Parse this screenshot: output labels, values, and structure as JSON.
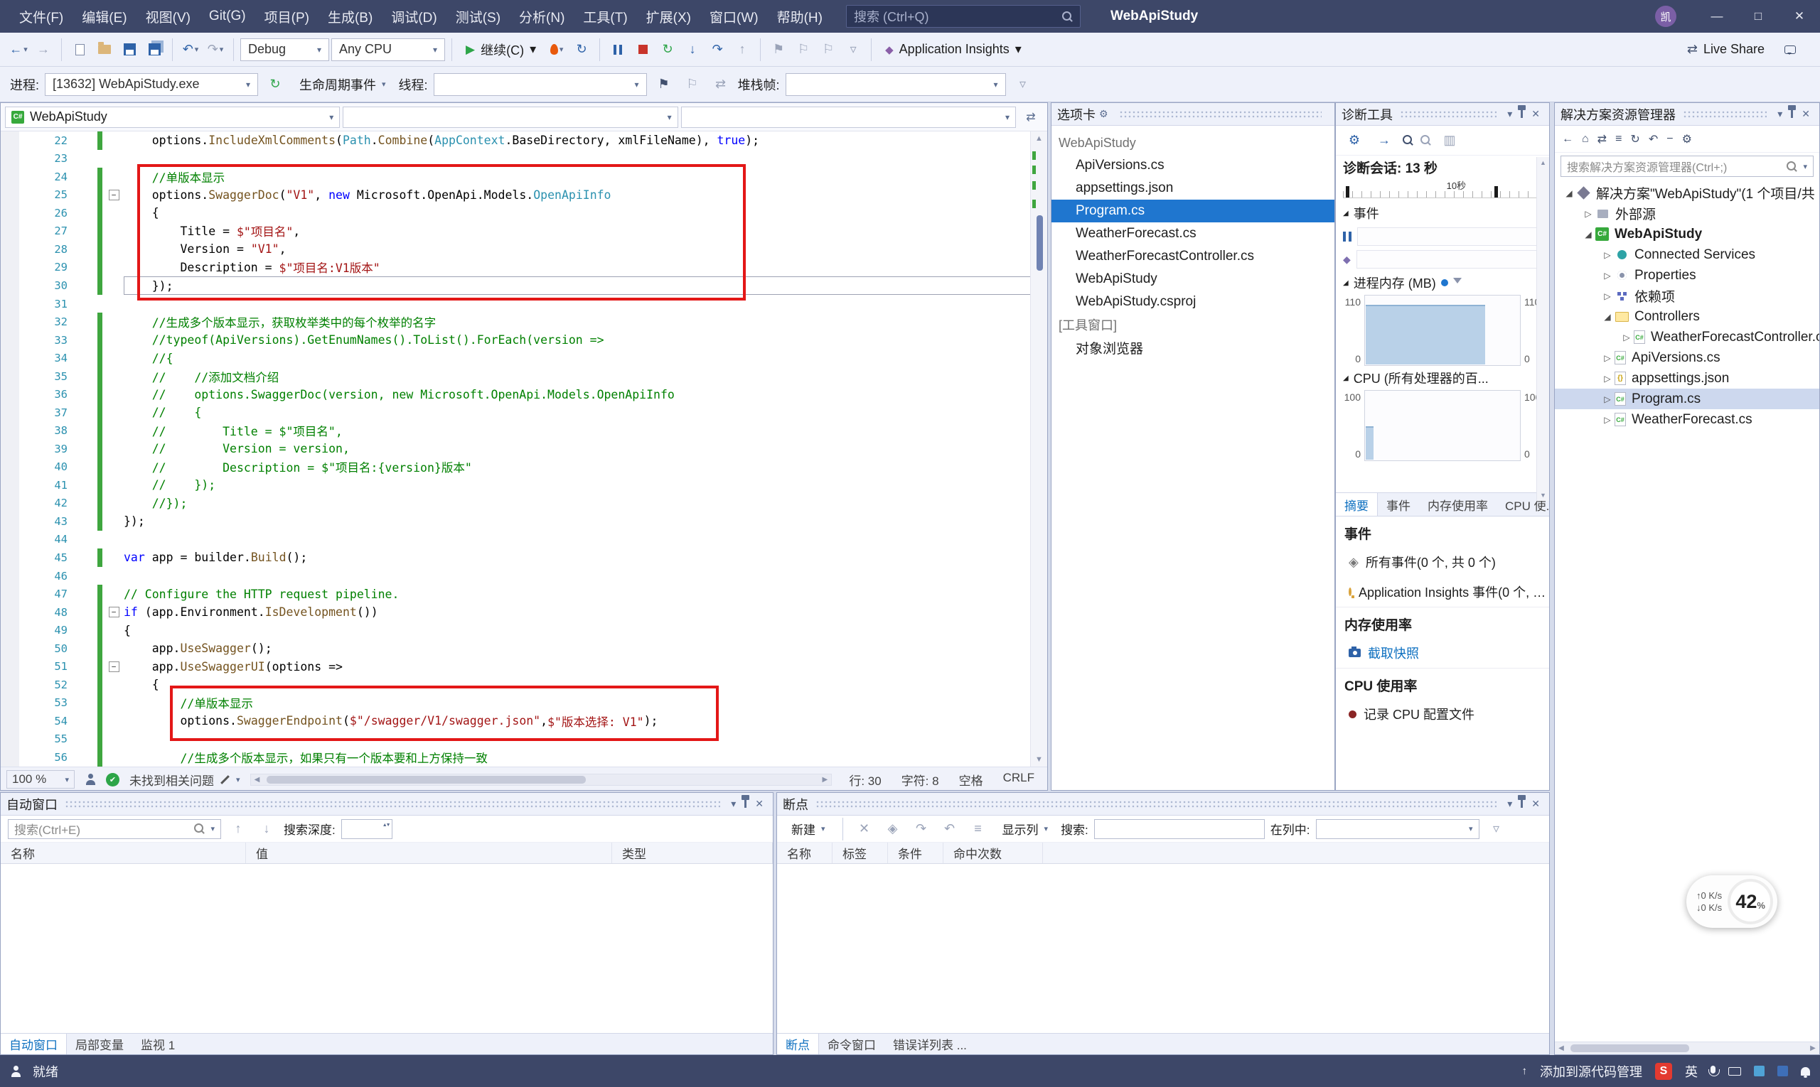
{
  "icons": {
    "dropdown": "▾",
    "overflow": "▿",
    "close": "✕",
    "minimize": "—",
    "maximize": "□",
    "gear": "⚙",
    "expanded": "◢",
    "collapsed": "▷",
    "up": "▲",
    "down": "▼",
    "left": "◀",
    "right": "▶",
    "undo": "↶",
    "redo": "↷",
    "refresh": "↻",
    "back": "←",
    "forward": "→",
    "flag": "⚑",
    "flag2": "⚐",
    "step_into": "↓",
    "step_over": "↷",
    "step_out": "↑",
    "play": "▶",
    "check": "✔",
    "fold": "−",
    "swap": "⇄",
    "home": "⌂",
    "diamond": "◆",
    "list": "≡",
    "chart": "▥",
    "allevents": "◈"
  },
  "title_bar": {
    "menus": [
      "文件(F)",
      "编辑(E)",
      "视图(V)",
      "Git(G)",
      "项目(P)",
      "生成(B)",
      "调试(D)",
      "测试(S)",
      "分析(N)",
      "工具(T)",
      "扩展(X)",
      "窗口(W)",
      "帮助(H)"
    ],
    "search_placeholder": "搜索 (Ctrl+Q)",
    "app_title": "WebApiStudy",
    "avatar": "凯"
  },
  "toolbar_main": {
    "config": "Debug",
    "platform": "Any CPU",
    "continue_label": "继续(C)",
    "app_insights_label": "Application Insights",
    "live_share_label": "Live Share"
  },
  "toolbar_debug": {
    "process_label": "进程:",
    "process_value": "[13632] WebApiStudy.exe",
    "lifecycle_label": "生命周期事件",
    "thread_label": "线程:",
    "stack_label": "堆栈帧:"
  },
  "editor": {
    "nav_project": "WebApiStudy",
    "zoom": "100 %",
    "health": "未找到相关问题",
    "line_status": "行: 30",
    "char_status": "字符: 8",
    "spaces_status": "空格",
    "eol_status": "CRLF",
    "code": [
      {
        "num": 22,
        "chg": true,
        "seg": [
          [
            "pl",
            "    options."
          ],
          [
            "mth",
            "IncludeXmlComments"
          ],
          [
            "pl",
            "("
          ],
          [
            "cls",
            "Path"
          ],
          [
            "pl",
            "."
          ],
          [
            "mth",
            "Combine"
          ],
          [
            "pl",
            "("
          ],
          [
            "cls",
            "AppContext"
          ],
          [
            "pl",
            ".BaseDirectory, xmlFileName), "
          ],
          [
            "kw",
            "true"
          ],
          [
            "pl",
            ");"
          ]
        ]
      },
      {
        "num": 23,
        "seg": []
      },
      {
        "num": 24,
        "chg": true,
        "seg": [
          [
            "cm",
            "    //单版本显示"
          ]
        ]
      },
      {
        "num": 25,
        "chg": true,
        "fold": true,
        "seg": [
          [
            "pl",
            "    options."
          ],
          [
            "mth",
            "SwaggerDoc"
          ],
          [
            "pl",
            "("
          ],
          [
            "str",
            "\"V1\""
          ],
          [
            "pl",
            ", "
          ],
          [
            "kw",
            "new"
          ],
          [
            "pl",
            " Microsoft.OpenApi.Models."
          ],
          [
            "cls",
            "OpenApiInfo"
          ]
        ]
      },
      {
        "num": 26,
        "chg": true,
        "seg": [
          [
            "pl",
            "    {"
          ]
        ]
      },
      {
        "num": 27,
        "chg": true,
        "seg": [
          [
            "pl",
            "        Title = "
          ],
          [
            "str",
            "$\"项目名\""
          ],
          [
            "pl",
            ","
          ]
        ]
      },
      {
        "num": 28,
        "chg": true,
        "seg": [
          [
            "pl",
            "        Version = "
          ],
          [
            "str",
            "\"V1\""
          ],
          [
            "pl",
            ","
          ]
        ]
      },
      {
        "num": 29,
        "chg": true,
        "seg": [
          [
            "pl",
            "        Description = "
          ],
          [
            "str",
            "$\"项目名:V1版本\""
          ]
        ]
      },
      {
        "num": 30,
        "chg": true,
        "cur": true,
        "seg": [
          [
            "pl",
            "    });"
          ]
        ]
      },
      {
        "num": 31,
        "seg": []
      },
      {
        "num": 32,
        "chg": true,
        "seg": [
          [
            "cm",
            "    //生成多个版本显示，获取枚举类中的每个枚举的名字"
          ]
        ]
      },
      {
        "num": 33,
        "chg": true,
        "seg": [
          [
            "cm",
            "    //typeof(ApiVersions).GetEnumNames().ToList().ForEach(version =>"
          ]
        ]
      },
      {
        "num": 34,
        "chg": true,
        "seg": [
          [
            "cm",
            "    //{"
          ]
        ]
      },
      {
        "num": 35,
        "chg": true,
        "seg": [
          [
            "cm",
            "    //    //添加文档介绍"
          ]
        ]
      },
      {
        "num": 36,
        "chg": true,
        "seg": [
          [
            "cm",
            "    //    options.SwaggerDoc(version, new Microsoft.OpenApi.Models.OpenApiInfo"
          ]
        ]
      },
      {
        "num": 37,
        "chg": true,
        "seg": [
          [
            "cm",
            "    //    {"
          ]
        ]
      },
      {
        "num": 38,
        "chg": true,
        "seg": [
          [
            "cm",
            "    //        Title = $\"项目名\","
          ]
        ]
      },
      {
        "num": 39,
        "chg": true,
        "seg": [
          [
            "cm",
            "    //        Version = version,"
          ]
        ]
      },
      {
        "num": 40,
        "chg": true,
        "seg": [
          [
            "cm",
            "    //        Description = $\"项目名:{version}版本\""
          ]
        ]
      },
      {
        "num": 41,
        "chg": true,
        "seg": [
          [
            "cm",
            "    //    });"
          ]
        ]
      },
      {
        "num": 42,
        "chg": true,
        "seg": [
          [
            "cm",
            "    //});"
          ]
        ]
      },
      {
        "num": 43,
        "chg": true,
        "seg": [
          [
            "pl",
            "});"
          ]
        ]
      },
      {
        "num": 44,
        "seg": []
      },
      {
        "num": 45,
        "chg": true,
        "seg": [
          [
            "kw",
            "var"
          ],
          [
            "pl",
            " app = builder."
          ],
          [
            "mth",
            "Build"
          ],
          [
            "pl",
            "();"
          ]
        ]
      },
      {
        "num": 46,
        "seg": []
      },
      {
        "num": 47,
        "chg": true,
        "seg": [
          [
            "cm",
            "// Configure the HTTP request pipeline."
          ]
        ]
      },
      {
        "num": 48,
        "chg": true,
        "fold": true,
        "seg": [
          [
            "kw",
            "if"
          ],
          [
            "pl",
            " (app.Environment."
          ],
          [
            "mth",
            "IsDevelopment"
          ],
          [
            "pl",
            "())"
          ]
        ]
      },
      {
        "num": 49,
        "chg": true,
        "seg": [
          [
            "pl",
            "{"
          ]
        ]
      },
      {
        "num": 50,
        "chg": true,
        "seg": [
          [
            "pl",
            "    app."
          ],
          [
            "mth",
            "UseSwagger"
          ],
          [
            "pl",
            "();"
          ]
        ]
      },
      {
        "num": 51,
        "chg": true,
        "fold": true,
        "seg": [
          [
            "pl",
            "    app."
          ],
          [
            "mth",
            "UseSwaggerUI"
          ],
          [
            "pl",
            "(options =>"
          ]
        ]
      },
      {
        "num": 52,
        "chg": true,
        "seg": [
          [
            "pl",
            "    {"
          ]
        ]
      },
      {
        "num": 53,
        "chg": true,
        "seg": [
          [
            "cm",
            "        //单版本显示"
          ]
        ]
      },
      {
        "num": 54,
        "chg": true,
        "seg": [
          [
            "pl",
            "        options."
          ],
          [
            "mth",
            "SwaggerEndpoint"
          ],
          [
            "pl",
            "("
          ],
          [
            "str",
            "$\"/swagger/V1/swagger.json\""
          ],
          [
            "pl",
            ","
          ],
          [
            "str",
            "$\"版本选择: V1\""
          ],
          [
            "pl",
            ");"
          ]
        ]
      },
      {
        "num": 55,
        "chg": true,
        "seg": []
      },
      {
        "num": 56,
        "chg": true,
        "seg": [
          [
            "cm",
            "        //生成多个版本显示，如果只有一个版本要和上方保持一致"
          ]
        ]
      }
    ]
  },
  "tabs_panel": {
    "title": "选项卡",
    "groups": [
      {
        "header": "WebApiStudy",
        "items": [
          {
            "label": "ApiVersions.cs"
          },
          {
            "label": "appsettings.json"
          },
          {
            "label": "Program.cs",
            "selected": true
          },
          {
            "label": "WeatherForecast.cs"
          },
          {
            "label": "WeatherForecastController.cs"
          },
          {
            "label": "WebApiStudy"
          },
          {
            "label": "WebApiStudy.csproj"
          }
        ]
      },
      {
        "header": "[工具窗口]",
        "items": [
          {
            "label": "对象浏览器"
          }
        ]
      }
    ]
  },
  "diagnostics": {
    "title": "诊断工具",
    "session_label": "诊断会话: 13 秒",
    "ruler_label": "10秒",
    "events_header": "事件",
    "memory_header": "进程内存 (MB)",
    "cpu_header": "CPU (所有处理器的百...",
    "mem_max": "110",
    "mem_min": "0",
    "cpu_max": "100",
    "cpu_min": "0",
    "tabs": [
      "摘要",
      "事件",
      "内存使用率",
      "CPU 使.."
    ],
    "summary": {
      "events_header": "事件",
      "all_events": "所有事件(0 个, 共 0 个)",
      "ai_events": "Application Insights 事件(0 个, …",
      "memory_header": "内存使用率",
      "snapshot": "截取快照",
      "cpu_header": "CPU 使用率",
      "record_cpu": "记录 CPU 配置文件"
    }
  },
  "solution_explorer": {
    "title": "解决方案资源管理器",
    "search_placeholder": "搜索解决方案资源管理器(Ctrl+;)",
    "tree": [
      {
        "label": "解决方案\"WebApiStudy\"(1 个项目/共",
        "icon": "solution",
        "level": 0,
        "arrow": "exp"
      },
      {
        "label": "外部源",
        "icon": "external",
        "level": 1,
        "arrow": "col"
      },
      {
        "label": "WebApiStudy",
        "icon": "csproj",
        "level": 1,
        "arrow": "exp",
        "bold": true
      },
      {
        "label": "Connected Services",
        "icon": "connected",
        "level": 2,
        "arrow": "col"
      },
      {
        "label": "Properties",
        "icon": "properties",
        "level": 2,
        "arrow": "col"
      },
      {
        "label": "依赖项",
        "icon": "dependencies",
        "level": 2,
        "arrow": "col"
      },
      {
        "label": "Controllers",
        "icon": "folder",
        "level": 2,
        "arrow": "exp"
      },
      {
        "label": "WeatherForecastController.cs",
        "icon": "cs",
        "level": 3,
        "arrow": "col"
      },
      {
        "label": "ApiVersions.cs",
        "icon": "cs",
        "level": 2,
        "arrow": "col"
      },
      {
        "label": "appsettings.json",
        "icon": "json",
        "level": 2,
        "arrow": "col"
      },
      {
        "label": "Program.cs",
        "icon": "cs",
        "level": 2,
        "arrow": "col",
        "selected": true
      },
      {
        "label": "WeatherForecast.cs",
        "icon": "cs",
        "level": 2,
        "arrow": "col"
      }
    ]
  },
  "autos_window": {
    "title": "自动窗口",
    "search_placeholder": "搜索(Ctrl+E)",
    "depth_label": "搜索深度:",
    "columns": [
      "名称",
      "值",
      "类型"
    ],
    "tabs": [
      "自动窗口",
      "局部变量",
      "监视 1"
    ],
    "active_tab": 0
  },
  "breakpoints_window": {
    "title": "断点",
    "new_label": "新建",
    "show_columns_label": "显示列",
    "search_label": "搜索:",
    "in_column_label": "在列中:",
    "columns": [
      "名称",
      "标签",
      "条件",
      "命中次数"
    ],
    "tabs": [
      "断点",
      "命令窗口",
      "错误详列表 ..."
    ],
    "active_tab": 0
  },
  "status_bar": {
    "ready": "就绪",
    "add_source_control": "添加到源代码管理",
    "ime_badge": "S",
    "ime_lang": "英"
  },
  "net_widget": {
    "up": "↑0 K/s",
    "down": "↓0 K/s",
    "percent": "42",
    "unit": "%"
  }
}
